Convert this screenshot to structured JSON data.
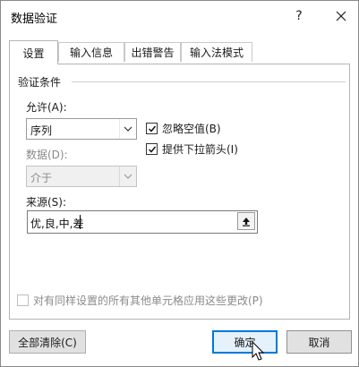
{
  "dialog": {
    "title": "数据验证",
    "help_label": "?",
    "close_label": "✕"
  },
  "tabs": [
    {
      "label": "设置",
      "active": true
    },
    {
      "label": "输入信息",
      "active": false
    },
    {
      "label": "出错警告",
      "active": false
    },
    {
      "label": "输入法模式",
      "active": false
    }
  ],
  "settings": {
    "group_label": "验证条件",
    "allow": {
      "label": "允许(A):",
      "value": "序列"
    },
    "data": {
      "label": "数据(D):",
      "value": "介于",
      "disabled": true
    },
    "ignore_blank": {
      "label": "忽略空值(B)",
      "checked": true
    },
    "in_cell_dropdown": {
      "label": "提供下拉箭头(I)",
      "checked": true
    },
    "source": {
      "label": "来源(S):",
      "value": "优,良,中,差"
    },
    "apply_all": {
      "label": "对有同样设置的所有其他单元格应用这些更改(P)",
      "checked": false,
      "disabled": true
    }
  },
  "buttons": {
    "clear_all": "全部清除(C)",
    "ok": "确定",
    "cancel": "取消"
  },
  "colors": {
    "accent": "#0078d7",
    "disabled_text": "#8a8a8a"
  }
}
